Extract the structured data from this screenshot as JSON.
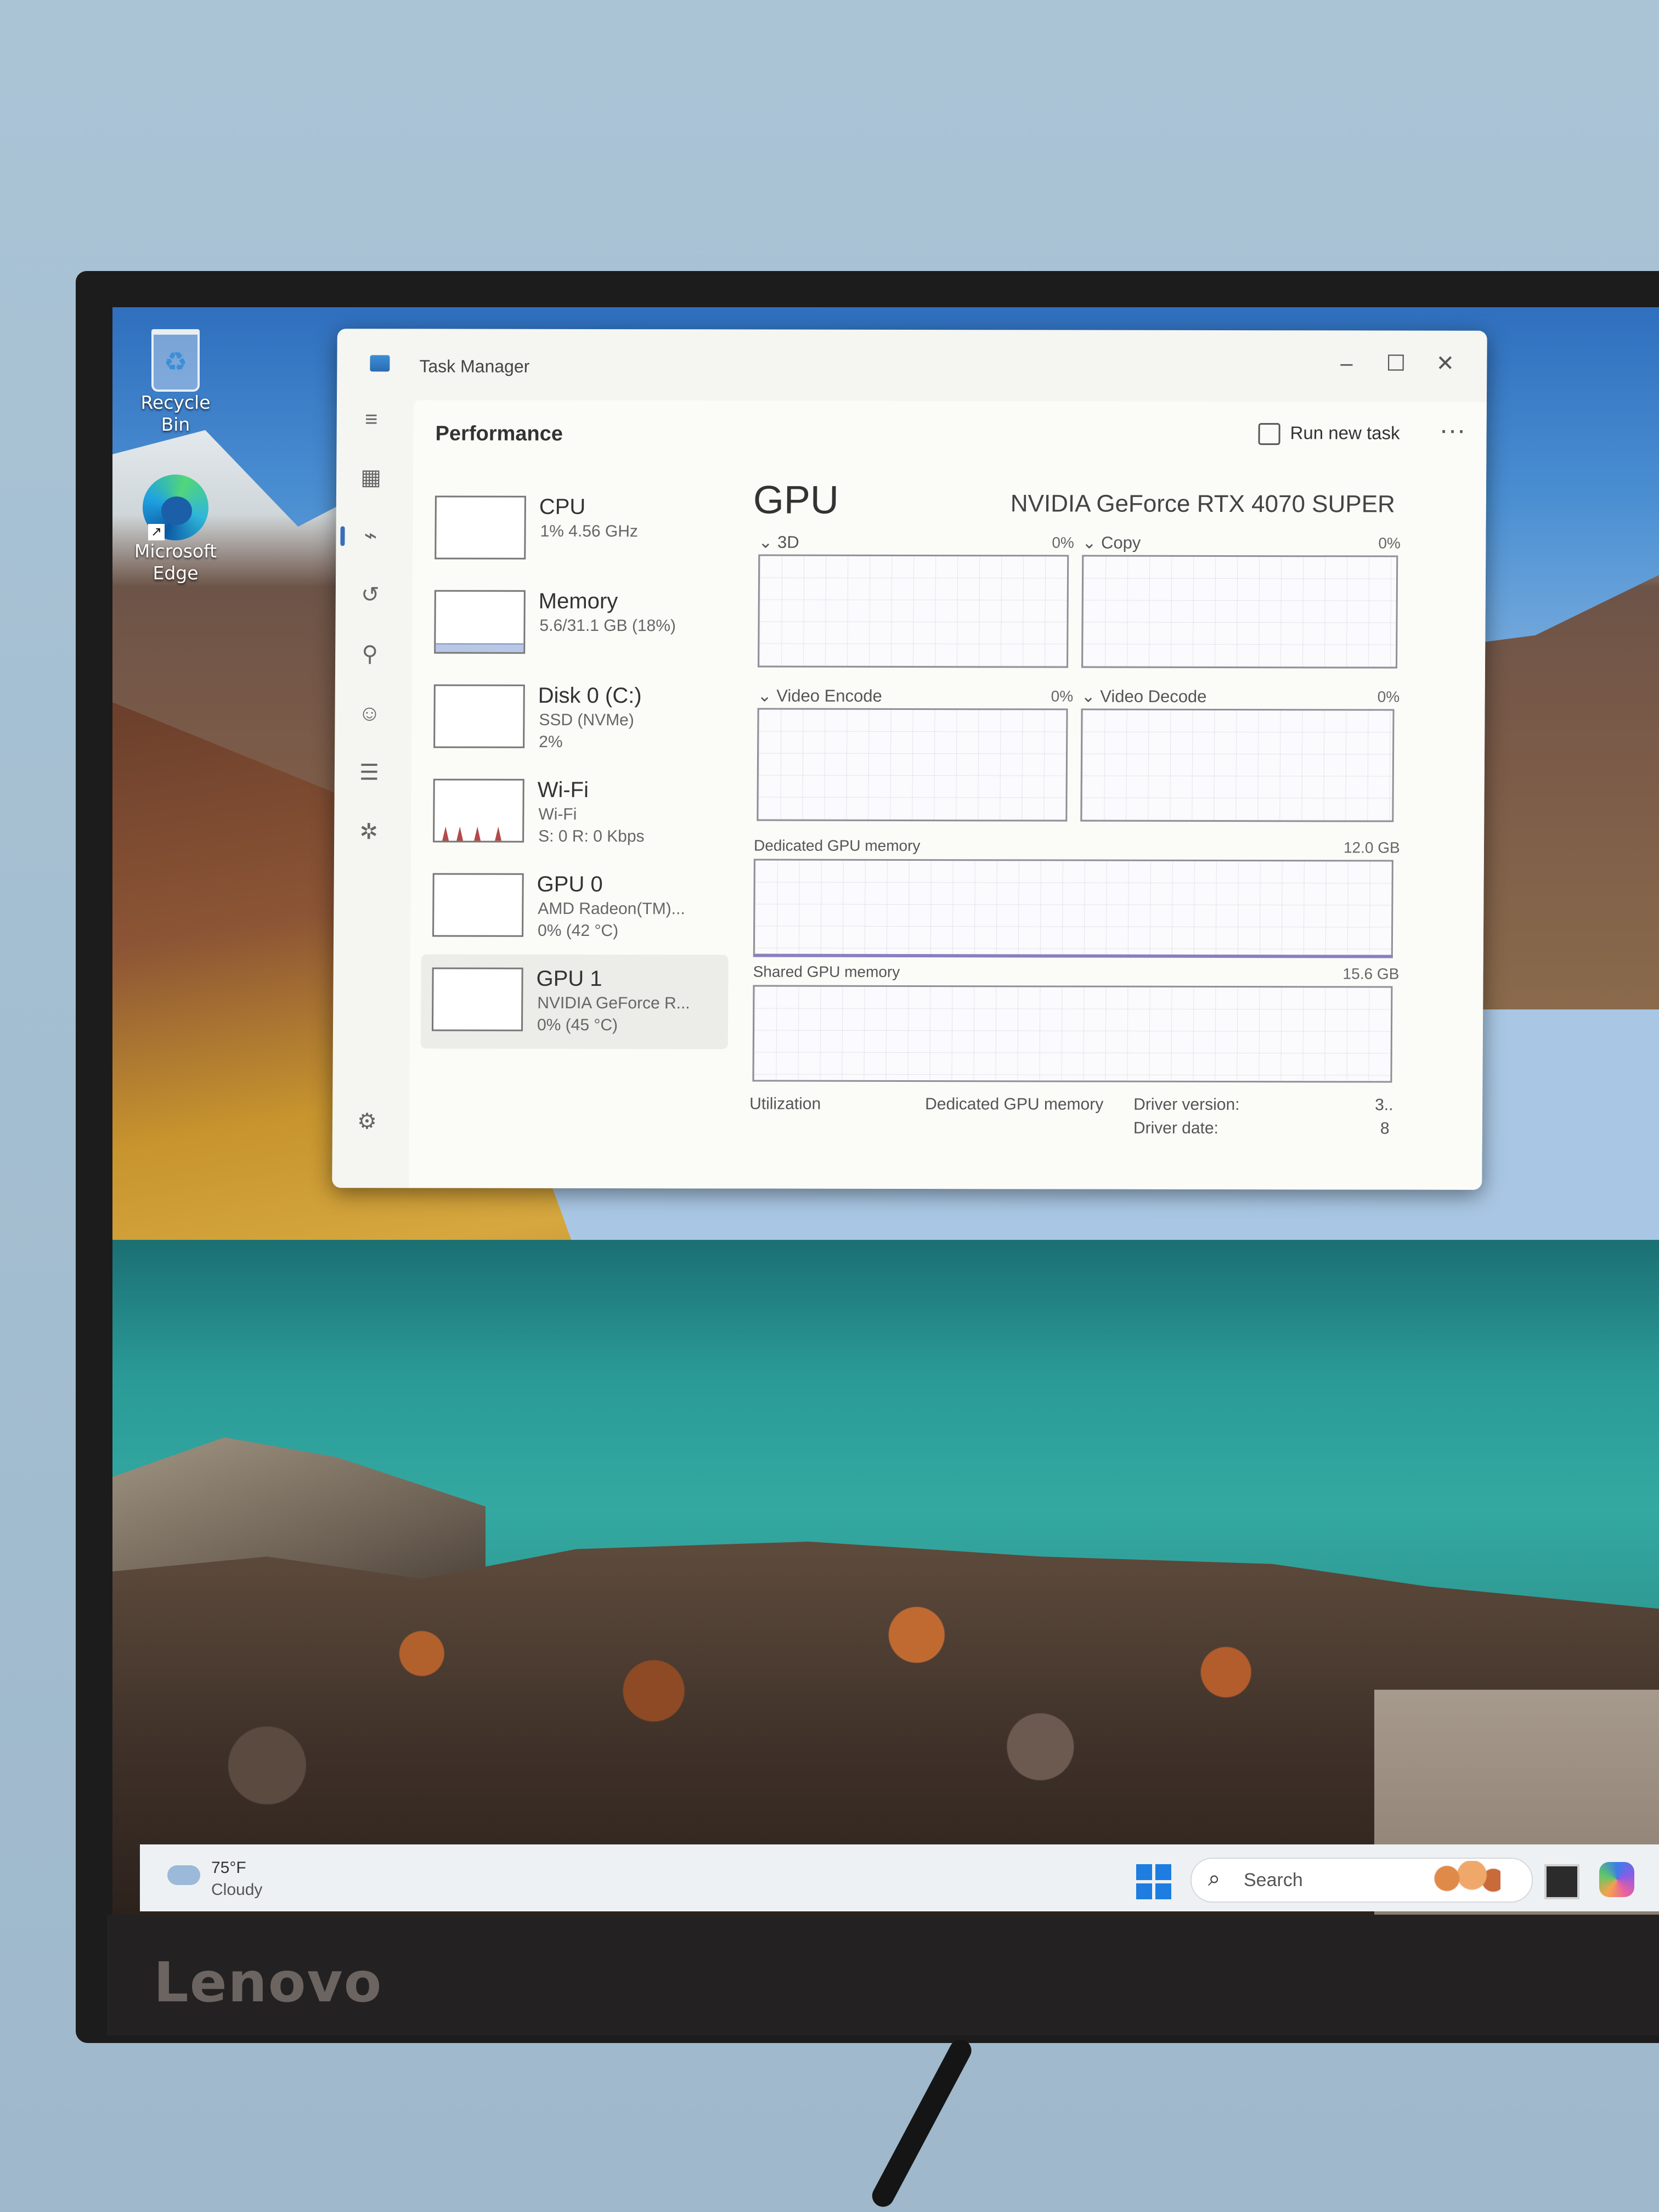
{
  "monitor": {
    "brand": "Lenovo"
  },
  "desktop": {
    "icons": [
      {
        "label": "Recycle Bin",
        "icon": "recycle-bin-icon"
      },
      {
        "label_line1": "Microsoft",
        "label_line2": "Edge",
        "icon": "edge-icon"
      }
    ]
  },
  "task_manager": {
    "title": "Task Manager",
    "controls": {
      "minimize": "–",
      "maximize": "☐",
      "close": "✕"
    },
    "nav_icons": [
      "menu-icon",
      "processes-icon",
      "performance-icon",
      "app-history-icon",
      "startup-icon",
      "users-icon",
      "details-icon",
      "services-icon",
      "settings-icon"
    ],
    "page_title": "Performance",
    "run_new_task": "Run new task",
    "more": "···",
    "resources": [
      {
        "name": "CPU",
        "sub1": "1% 4.56 GHz",
        "sub2": ""
      },
      {
        "name": "Memory",
        "sub1": "5.6/31.1 GB (18%)",
        "sub2": ""
      },
      {
        "name": "Disk 0 (C:)",
        "sub1": "SSD (NVMe)",
        "sub2": "2%"
      },
      {
        "name": "Wi-Fi",
        "sub1": "Wi-Fi",
        "sub2": "S: 0 R: 0 Kbps"
      },
      {
        "name": "GPU 0",
        "sub1": "AMD Radeon(TM)...",
        "sub2": "0% (42 °C)"
      },
      {
        "name": "GPU 1",
        "sub1": "NVIDIA GeForce R...",
        "sub2": "0% (45 °C)"
      }
    ],
    "selected_resource": "GPU 1",
    "detail": {
      "title": "GPU",
      "model": "NVIDIA GeForce RTX 4070 SUPER",
      "engines": [
        {
          "label": "3D",
          "pct": "0%"
        },
        {
          "label": "Copy",
          "pct": "0%"
        },
        {
          "label": "Video Encode",
          "pct": "0%"
        },
        {
          "label": "Video Decode",
          "pct": "0%"
        }
      ],
      "dedicated_label": "Dedicated GPU memory",
      "dedicated_max": "12.0 GB",
      "shared_label": "Shared GPU memory",
      "shared_max": "15.6 GB",
      "stats": {
        "utilization_label": "Utilization",
        "dedicated_label": "Dedicated GPU memory",
        "driver_version_label": "Driver version:",
        "driver_version_value": "3..",
        "driver_date_label": "Driver date:",
        "driver_date_value": "8"
      }
    }
  },
  "taskbar": {
    "weather_temp": "75°F",
    "weather_cond": "Cloudy",
    "search_placeholder": "Search"
  }
}
